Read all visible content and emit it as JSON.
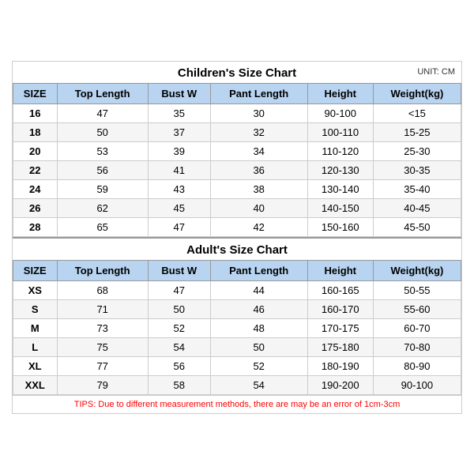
{
  "unit": "UNIT: CM",
  "children": {
    "title": "Children's Size Chart",
    "headers": [
      "SIZE",
      "Top Length",
      "Bust W",
      "Pant Length",
      "Height",
      "Weight(kg)"
    ],
    "rows": [
      [
        "16",
        "47",
        "35",
        "30",
        "90-100",
        "<15"
      ],
      [
        "18",
        "50",
        "37",
        "32",
        "100-110",
        "15-25"
      ],
      [
        "20",
        "53",
        "39",
        "34",
        "110-120",
        "25-30"
      ],
      [
        "22",
        "56",
        "41",
        "36",
        "120-130",
        "30-35"
      ],
      [
        "24",
        "59",
        "43",
        "38",
        "130-140",
        "35-40"
      ],
      [
        "26",
        "62",
        "45",
        "40",
        "140-150",
        "40-45"
      ],
      [
        "28",
        "65",
        "47",
        "42",
        "150-160",
        "45-50"
      ]
    ]
  },
  "adult": {
    "title": "Adult's Size Chart",
    "headers": [
      "SIZE",
      "Top Length",
      "Bust W",
      "Pant Length",
      "Height",
      "Weight(kg)"
    ],
    "rows": [
      [
        "XS",
        "68",
        "47",
        "44",
        "160-165",
        "50-55"
      ],
      [
        "S",
        "71",
        "50",
        "46",
        "160-170",
        "55-60"
      ],
      [
        "M",
        "73",
        "52",
        "48",
        "170-175",
        "60-70"
      ],
      [
        "L",
        "75",
        "54",
        "50",
        "175-180",
        "70-80"
      ],
      [
        "XL",
        "77",
        "56",
        "52",
        "180-190",
        "80-90"
      ],
      [
        "XXL",
        "79",
        "58",
        "54",
        "190-200",
        "90-100"
      ]
    ]
  },
  "tips": "TIPS: Due to different measurement methods, there are may be an error of 1cm-3cm"
}
